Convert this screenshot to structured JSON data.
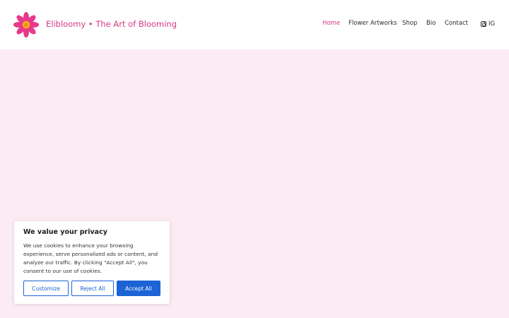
{
  "header": {
    "site_title": "Elibloomy • The Art of Blooming",
    "logo_icon": "flower-logo-icon",
    "nav": [
      {
        "label": "Home",
        "active": true
      },
      {
        "label": "Flower Artworks",
        "active": false
      },
      {
        "label": "Shop",
        "active": false
      },
      {
        "label": "Bio",
        "active": false
      },
      {
        "label": "Contact",
        "active": false
      }
    ],
    "social": {
      "icon": "instagram-icon",
      "label": "IG"
    }
  },
  "colors": {
    "accent": "#d6397f",
    "hero_background": "#fcebf3",
    "button_blue": "#1c63d6"
  },
  "cookie_banner": {
    "title": "We value your privacy",
    "text": "We use cookies to enhance your browsing experience, serve personalized ads or content, and analyze our traffic. By clicking \"Accept All\", you consent to our use of cookies.",
    "buttons": {
      "customize": "Customize",
      "reject": "Reject All",
      "accept": "Accept All"
    }
  }
}
